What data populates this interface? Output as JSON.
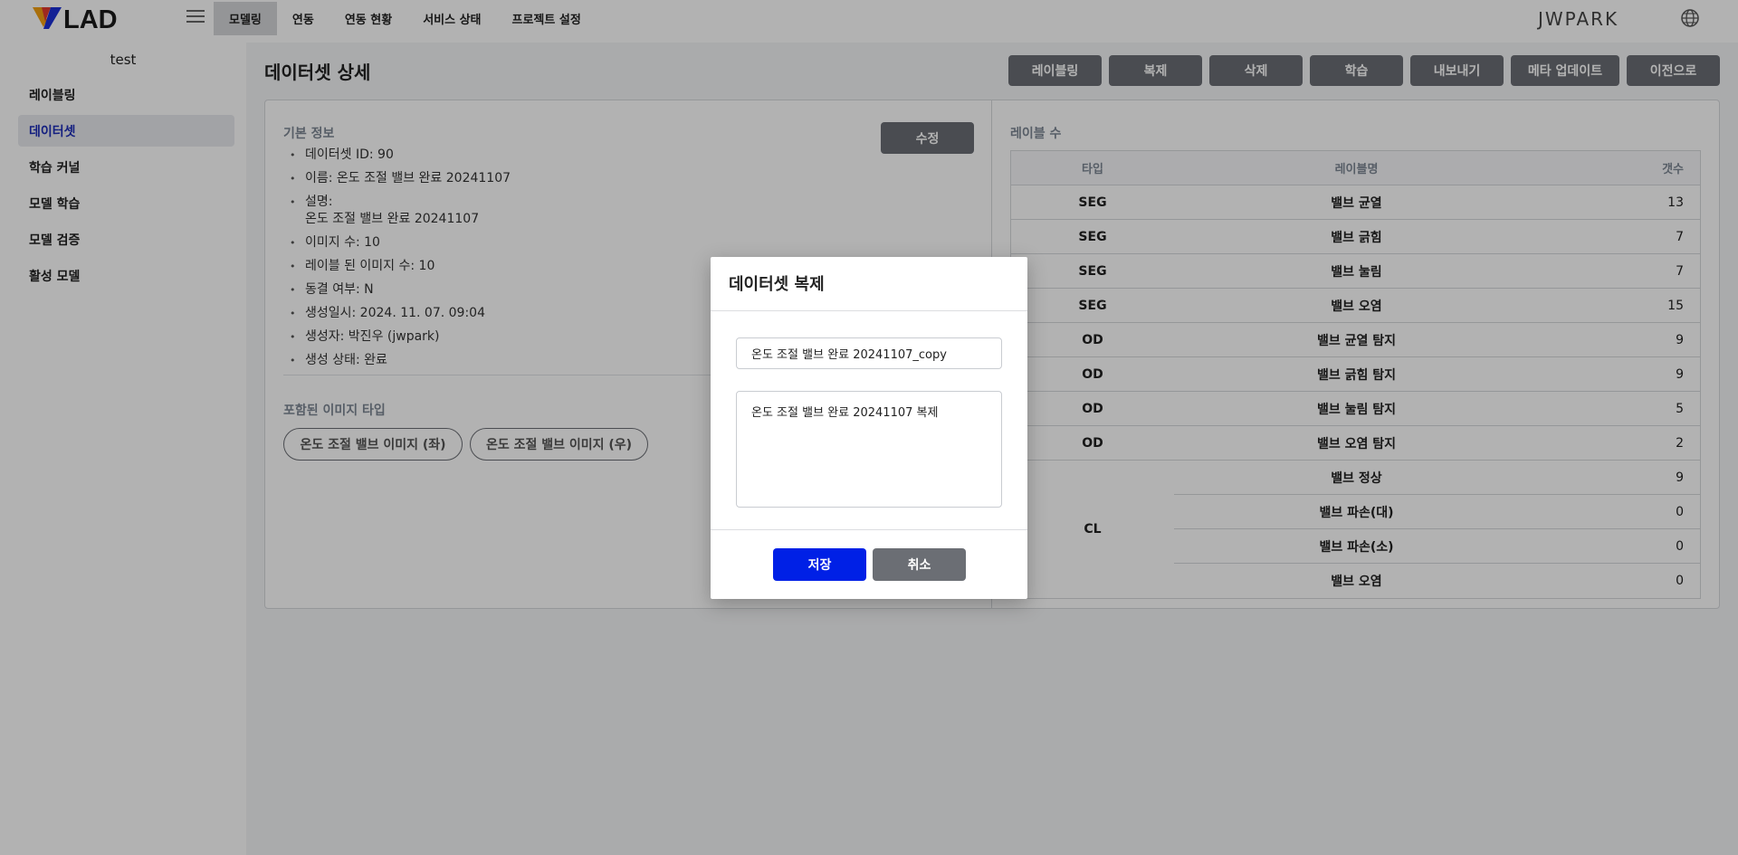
{
  "header": {
    "logo_text": "VLAD",
    "nav": [
      "모델링",
      "연동",
      "연동 현황",
      "서비스 상태",
      "프로젝트 설정"
    ],
    "user": "JWPARK"
  },
  "sidebar": {
    "project": "test",
    "items": [
      "레이블링",
      "데이터셋",
      "학습 커널",
      "모델 학습",
      "모델 검증",
      "활성 모델"
    ]
  },
  "page": {
    "title": "데이터셋 상세",
    "actions": [
      "레이블링",
      "복제",
      "삭제",
      "학습",
      "내보내기",
      "메타 업데이트",
      "이전으로"
    ]
  },
  "info": {
    "section_title": "기본 정보",
    "edit_label": "수정",
    "id": "데이터셋 ID: 90",
    "name": "이름: 온도 조절 밸브 완료 20241107",
    "desc_label": "설명:",
    "desc_value": "온도 조절 밸브 완료 20241107",
    "image_count": "이미지 수: 10",
    "labeled_count": "레이블 된 이미지 수: 10",
    "frozen": "동결 여부: N",
    "created_at": "생성일시: 2024. 11. 07. 09:04",
    "creator": "생성자: 박진우 (jwpark)",
    "status": "생성 상태: 완료"
  },
  "image_types": {
    "section_title": "포함된 이미지 타입",
    "chips": [
      "온도 조절 밸브 이미지 (좌)",
      "온도 조절 밸브 이미지 (우)"
    ]
  },
  "labels": {
    "section_title": "레이블 수",
    "headers": {
      "type": "타입",
      "name": "레이블명",
      "count": "갯수"
    },
    "rows": [
      {
        "type": "SEG",
        "name": "밸브 균열",
        "count": "13"
      },
      {
        "type": "SEG",
        "name": "밸브 긁힘",
        "count": "7"
      },
      {
        "type": "SEG",
        "name": "밸브 눌림",
        "count": "7"
      },
      {
        "type": "SEG",
        "name": "밸브 오염",
        "count": "15"
      },
      {
        "type": "OD",
        "name": "밸브 균열 탐지",
        "count": "9"
      },
      {
        "type": "OD",
        "name": "밸브 긁힘 탐지",
        "count": "9"
      },
      {
        "type": "OD",
        "name": "밸브 눌림 탐지",
        "count": "5"
      },
      {
        "type": "OD",
        "name": "밸브 오염 탐지",
        "count": "2"
      }
    ],
    "cl_type": "CL",
    "cl_rows": [
      {
        "name": "밸브 정상",
        "count": "9"
      },
      {
        "name": "밸브 파손(대)",
        "count": "0"
      },
      {
        "name": "밸브 파손(소)",
        "count": "0"
      },
      {
        "name": "밸브 오염",
        "count": "0"
      }
    ]
  },
  "modal": {
    "title": "데이터셋 복제",
    "name_value": "온도 조절 밸브 완료 20241107_copy",
    "desc_value": "온도 조절 밸브 완료 20241107 복제",
    "save_label": "저장",
    "cancel_label": "취소"
  },
  "colors": {
    "accent": "#0020e6",
    "button_gray": "#6b6e74",
    "active_sidebar_text": "#1d2db8",
    "overlay": "rgba(0,0,0,0.3)"
  }
}
